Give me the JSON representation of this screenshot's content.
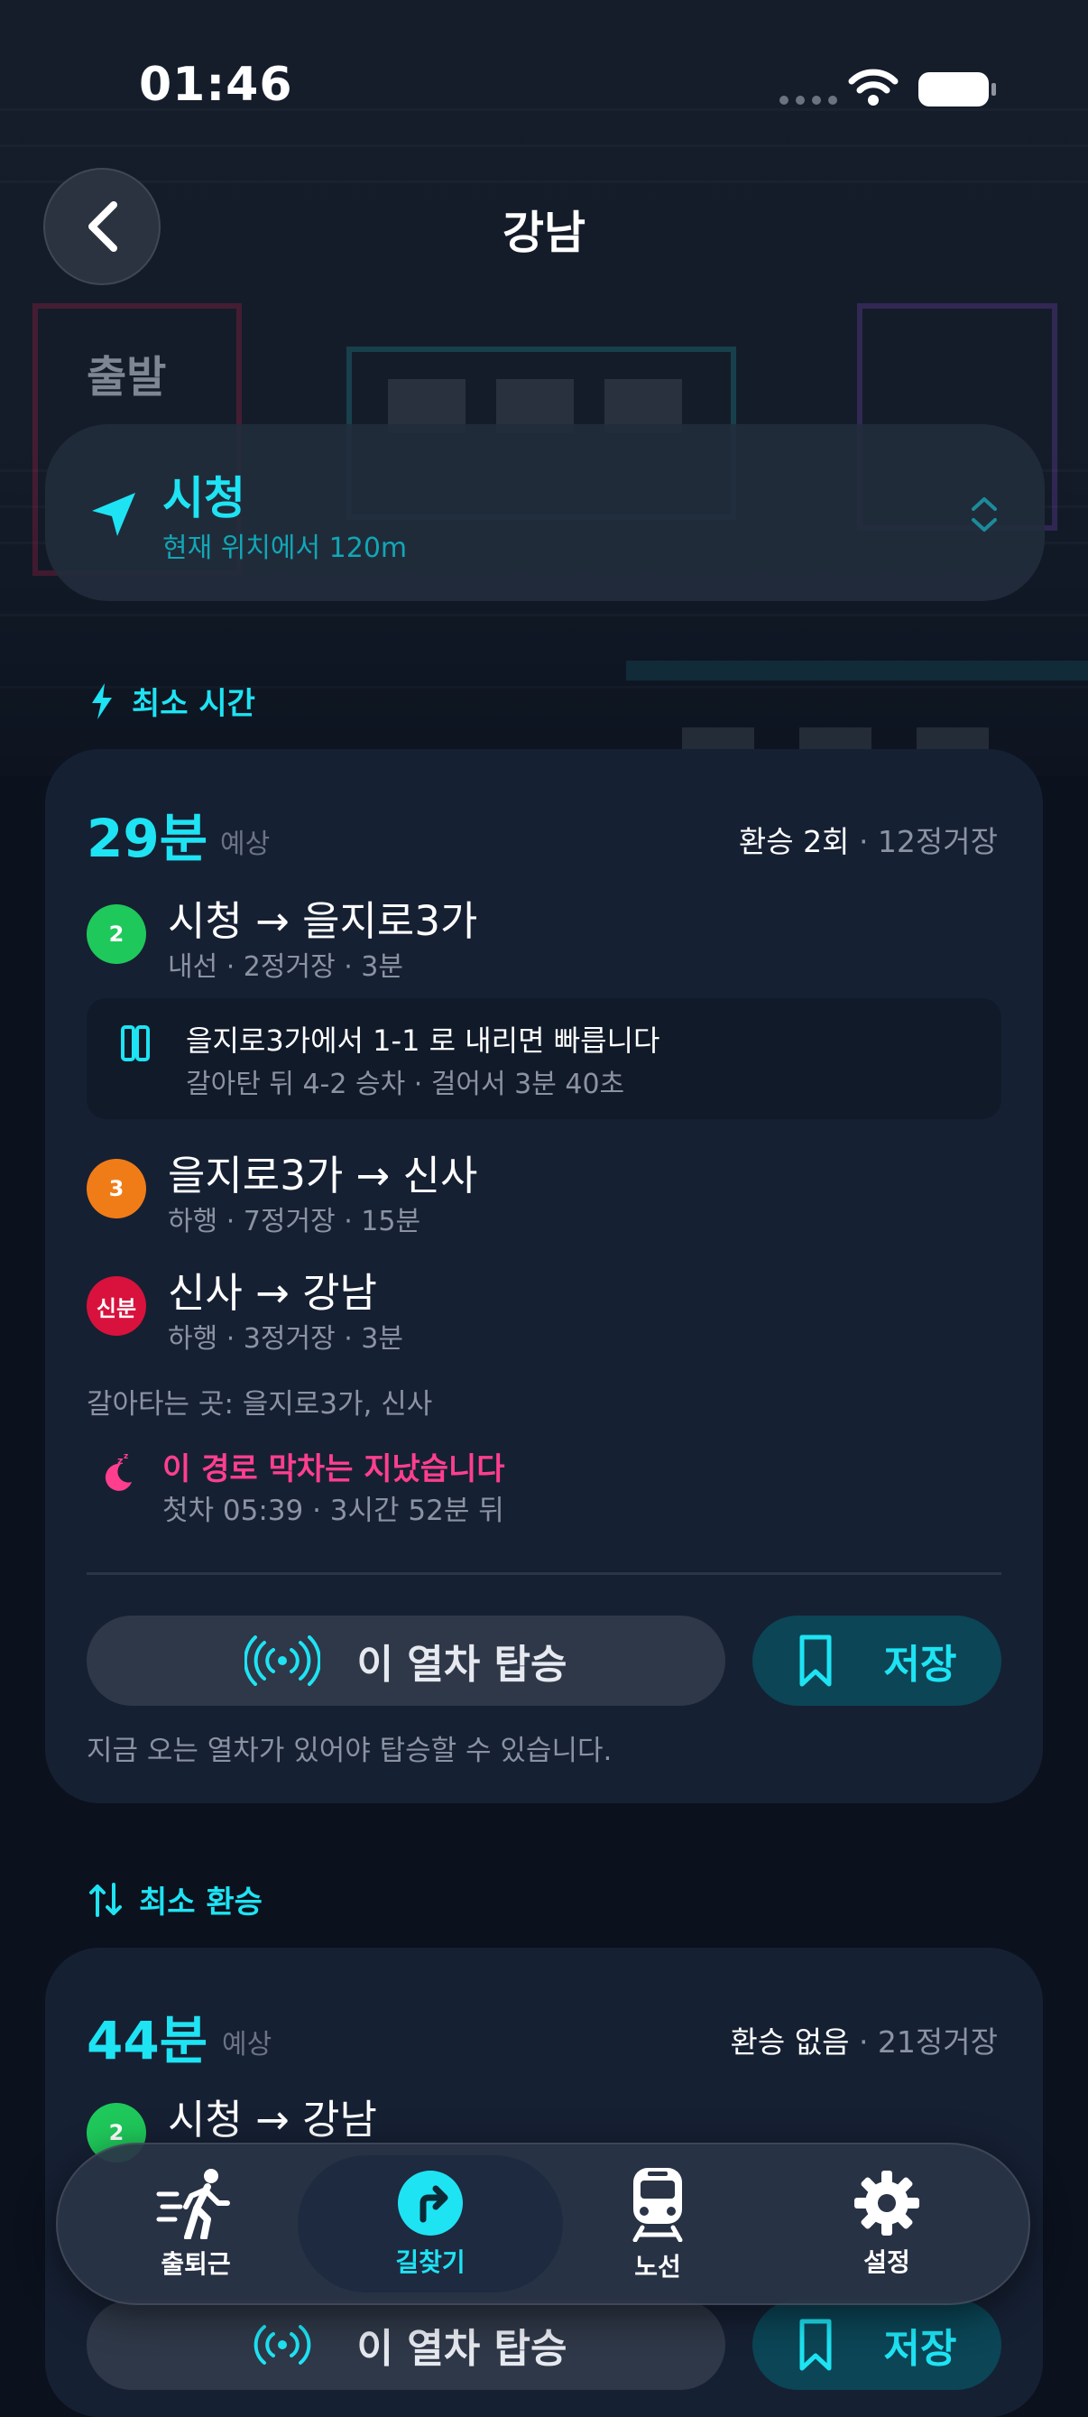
{
  "status_bar": {
    "time": "01:46"
  },
  "header": {
    "title": "강남",
    "back_icon": "chevron-left-icon"
  },
  "origin": {
    "section_label": "출발",
    "name": "시청",
    "distance": "현재 위치에서 120m"
  },
  "routes": [
    {
      "group_label": "최소 시간",
      "group_icon": "lightning-icon",
      "duration": "29분",
      "duration_suffix": "예상",
      "transfers": "환승 2회",
      "stops": "· 12정거장",
      "segments": [
        {
          "badge": "2",
          "badge_color": "#1fc85a",
          "title": "시청 → 을지로3가",
          "sub": "내선 · 2정거장 · 3분"
        },
        {
          "badge": "3",
          "badge_color": "#f07c18",
          "title": "을지로3가 → 신사",
          "sub": "하행 · 7정거장 · 15분"
        },
        {
          "badge": "신분",
          "badge_color": "#d8123c",
          "title": "신사 → 강남",
          "sub": "하행 · 3정거장 · 3분"
        }
      ],
      "tip": {
        "title": "을지로3가에서 1-1 로 내리면 빠릅니다",
        "sub": "갈아탄 뒤 4-2 승차 · 걸어서 3분 40초"
      },
      "transfer_note": "갈아타는 곳: 을지로3가, 신사",
      "last_train": {
        "title": "이 경로 막차는 지났습니다",
        "sub": "첫차 05:39 · 3시간 52분 뒤"
      },
      "board_label": "이 열차 탑승",
      "save_label": "저장",
      "board_note": "지금 오는 열차가 있어야 탑승할 수 있습니다."
    },
    {
      "group_label": "최소 환승",
      "group_icon": "transfer-arrows-icon",
      "duration": "44분",
      "duration_suffix": "예상",
      "transfers": "환승 없음",
      "stops": "· 21정거장",
      "segments": [
        {
          "badge": "2",
          "badge_color": "#1fc85a",
          "title": "시청 → 강남",
          "sub": ""
        }
      ],
      "board_label": "이 열차 탑승",
      "save_label": "저장"
    }
  ],
  "tabbar": {
    "items": [
      {
        "label": "출퇴근",
        "icon": "walking-person-icon"
      },
      {
        "label": "길찾기",
        "icon": "directions-icon",
        "active": true
      },
      {
        "label": "노선",
        "icon": "train-icon"
      },
      {
        "label": "설정",
        "icon": "gear-icon"
      }
    ]
  },
  "colors": {
    "accent": "#1ee3f3",
    "warning": "#ff3f8e",
    "background": "#0b111d",
    "card": "#162033"
  }
}
